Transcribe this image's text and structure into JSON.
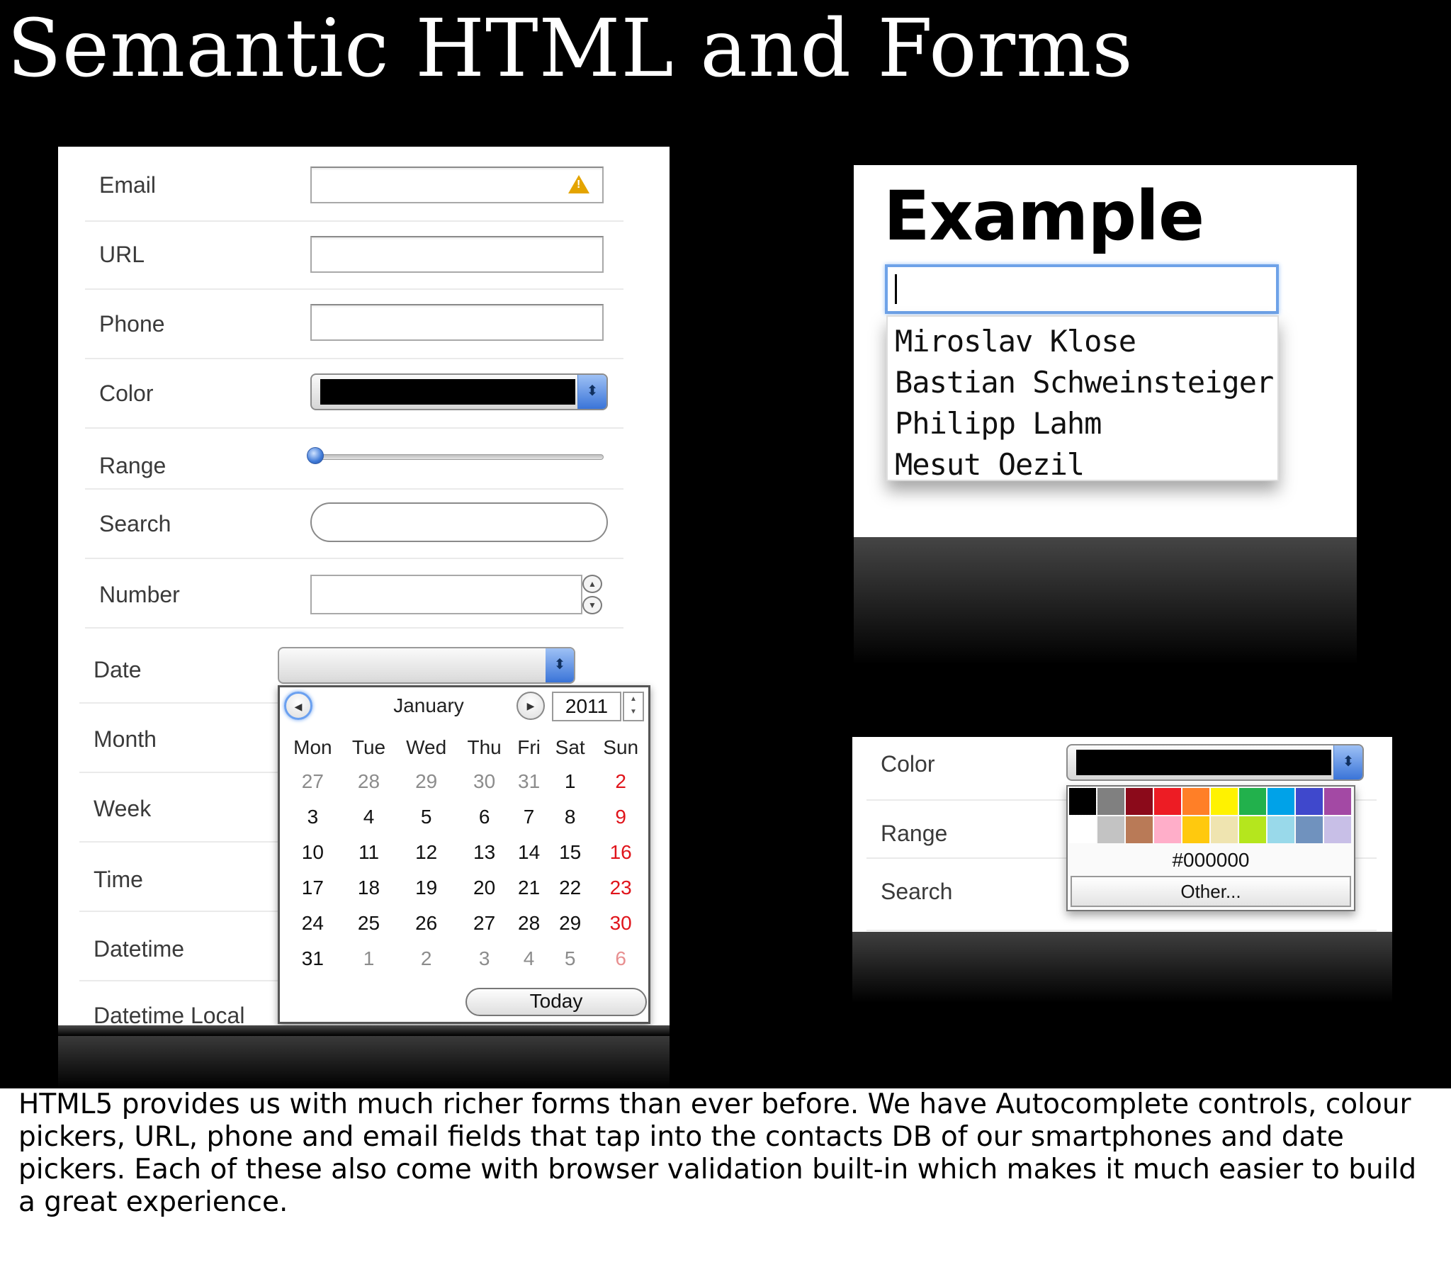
{
  "slide": {
    "title": "Semantic HTML and Forms",
    "caption": "HTML5 provides us with much richer forms than ever before. We have Autocomplete controls, colour pickers, URL, phone and email fields that tap into the contacts DB of our smartphones and date pickers. Each of these also come with browser validation built-in which makes it much easier to build a great experience."
  },
  "form": {
    "email_label": "Email",
    "url_label": "URL",
    "phone_label": "Phone",
    "color_label": "Color",
    "range_label": "Range",
    "range_value": 0,
    "search_label": "Search",
    "number_label": "Number",
    "date_label": "Date",
    "month_label": "Month",
    "week_label": "Week",
    "time_label": "Time",
    "datetime_label": "Datetime",
    "datetime_local_label": "Datetime Local",
    "warning_icon": "warning-icon"
  },
  "calendar": {
    "month": "January",
    "year": "2011",
    "weekdays": [
      "Mon",
      "Tue",
      "Wed",
      "Thu",
      "Fri",
      "Sat",
      "Sun"
    ],
    "weeks": [
      [
        "27",
        "28",
        "29",
        "30",
        "31",
        "1",
        "2"
      ],
      [
        "3",
        "4",
        "5",
        "6",
        "7",
        "8",
        "9"
      ],
      [
        "10",
        "11",
        "12",
        "13",
        "14",
        "15",
        "16"
      ],
      [
        "17",
        "18",
        "19",
        "20",
        "21",
        "22",
        "23"
      ],
      [
        "24",
        "25",
        "26",
        "27",
        "28",
        "29",
        "30"
      ],
      [
        "31",
        "1",
        "2",
        "3",
        "4",
        "5",
        "6"
      ]
    ],
    "today_label": "Today",
    "sunday_color": "#e0141b"
  },
  "example": {
    "title": "Example",
    "suggestions": [
      "Miroslav Klose",
      "Bastian Schweinsteiger",
      "Philipp Lahm",
      "Mesut Oezil"
    ]
  },
  "picker": {
    "color_label": "Color",
    "range_label": "Range",
    "search_label": "Search",
    "selected_color": "#000000",
    "hex_value": "#000000",
    "other_label": "Other...",
    "swatches_row1": [
      "#000000",
      "#808080",
      "#8b0a1a",
      "#ed1c24",
      "#ff7f27",
      "#fff200",
      "#22b14c",
      "#00a2e8",
      "#3f48cc",
      "#a349a4"
    ],
    "swatches_row2": [
      "#ffffff",
      "#c3c3c3",
      "#b97a57",
      "#ffaec9",
      "#ffc90e",
      "#efe4b0",
      "#b5e61d",
      "#99d9ea",
      "#7092be",
      "#c8bfe7"
    ]
  }
}
